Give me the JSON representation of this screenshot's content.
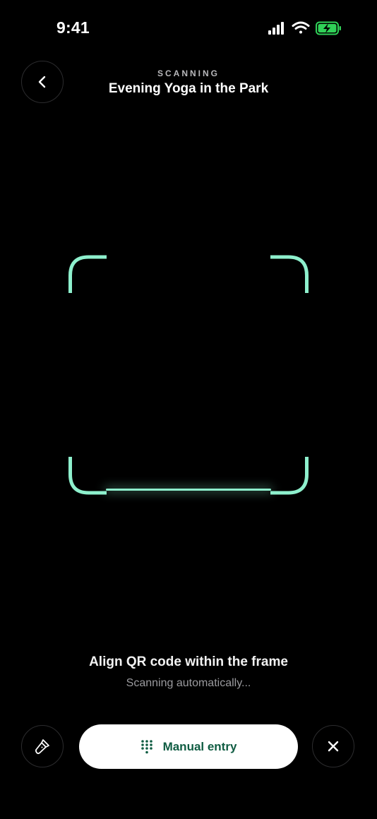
{
  "status_bar": {
    "time": "9:41",
    "icons": [
      "signal-icon",
      "wifi-icon",
      "battery-charging-icon"
    ],
    "battery_color": "#30d158"
  },
  "header": {
    "back_icon": "chevron-left-icon",
    "eyebrow": "SCANNING",
    "title": "Evening Yoga in the Park"
  },
  "scanner": {
    "frame_color": "#8ef0cd"
  },
  "instructions": {
    "title": "Align QR code within the frame",
    "subtitle": "Scanning automatically..."
  },
  "controls": {
    "flashlight_icon": "flashlight-icon",
    "manual_entry_icon": "keypad-icon",
    "manual_entry_label": "Manual entry",
    "manual_entry_color": "#0f5c42",
    "close_icon": "close-icon"
  }
}
